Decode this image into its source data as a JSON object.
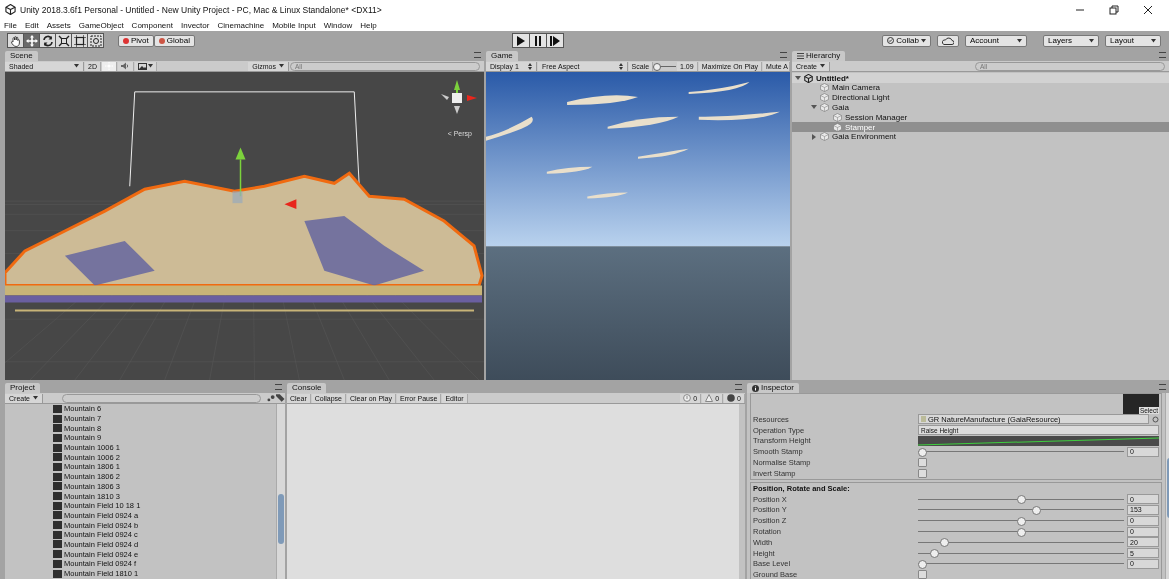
{
  "window": {
    "title": "Unity 2018.3.6f1 Personal - Untitled - New Unity Project - PC, Mac & Linux Standalone* <DX11>"
  },
  "menu": [
    "File",
    "Edit",
    "Assets",
    "GameObject",
    "Component",
    "Invector",
    "Cinemachine",
    "Mobile Input",
    "Window",
    "Help"
  ],
  "toolbar": {
    "tools": [
      {
        "kind": "hand",
        "selected": false
      },
      {
        "kind": "move",
        "selected": true
      },
      {
        "kind": "rotate",
        "selected": false
      },
      {
        "kind": "scale",
        "selected": false
      },
      {
        "kind": "rect",
        "selected": false
      },
      {
        "kind": "transform",
        "selected": false
      }
    ],
    "pivot": [
      "Pivot",
      "Global"
    ],
    "play": [
      {
        "kind": "play"
      },
      {
        "kind": "pause"
      },
      {
        "kind": "step"
      }
    ],
    "collab": "Collab",
    "account": "Account",
    "layers": "Layers",
    "layout": "Layout"
  },
  "scene": {
    "tab": "Scene",
    "shading": "Shaded",
    "mode_2d": "2D",
    "lighting": {
      "on": true
    },
    "audio": {
      "on": false
    },
    "gizmos": "Gizmos",
    "search": {
      "placeholder": "All"
    },
    "projection": "< Persp"
  },
  "game": {
    "tab": "Game",
    "display": "Display 1",
    "aspect": "Free Aspect",
    "scale_label": "Scale",
    "scale_slider": {
      "level": 0.1
    },
    "scale_value": "1.09",
    "maximize": "Maximize On Play",
    "mute": "Mute A"
  },
  "hierarchy": {
    "tab": "Hierarchy",
    "create": "Create",
    "search": {
      "placeholder": "All"
    },
    "scene": "Untitled*",
    "items": [
      {
        "label": "Main Camera",
        "selected": false
      },
      {
        "label": "Directional Light",
        "selected": false
      },
      {
        "label": "Gaia",
        "selected": false,
        "expanded": true,
        "children": [
          {
            "label": "Session Manager",
            "selected": false
          },
          {
            "label": "Stamper",
            "selected": true
          }
        ]
      },
      {
        "label": "Gaia Environment",
        "selected": false,
        "expanded": false
      }
    ]
  },
  "project": {
    "tab": "Project",
    "create": "Create",
    "items": [
      "Mountain 6",
      "Mountain 7",
      "Mountain 8",
      "Mountain 9",
      "Mountain 1006 1",
      "Mountain 1006 2",
      "Mountain 1806 1",
      "Mountain 1806 2",
      "Mountain 1806 3",
      "Mountain 1810 3",
      "Mountain Field 10 18 1",
      "Mountain Field 0924 a",
      "Mountain Field 0924 b",
      "Mountain Field 0924 c",
      "Mountain Field 0924 d",
      "Mountain Field 0924 e",
      "Mountain Field 0924 f",
      "Mountain Field 1810 1"
    ]
  },
  "console": {
    "tab": "Console",
    "buttons": [
      "Clear",
      "Collapse",
      "Clear on Play",
      "Error Pause",
      "Editor"
    ],
    "counts": [
      {
        "kind": "info",
        "value": "0"
      },
      {
        "kind": "warning",
        "value": "0"
      },
      {
        "kind": "error",
        "value": "0"
      }
    ]
  },
  "inspector": {
    "tab": "Inspector",
    "select": "Select",
    "rows": [
      {
        "kind": "object",
        "label": "Resources",
        "value": "GR NatureManufacture (GaiaResource)"
      },
      {
        "kind": "dropdown",
        "label": "Operation Type",
        "value": "Raise Height"
      },
      {
        "kind": "curve",
        "label": "Transform Height"
      },
      {
        "kind": "slider",
        "label": "Smooth Stamp",
        "level": 0,
        "value": "0"
      },
      {
        "kind": "checkbox",
        "label": "Normalise Stamp",
        "checked": false
      },
      {
        "kind": "checkbox",
        "label": "Invert Stamp",
        "checked": false
      }
    ],
    "section": "Position, Rotate and Scale:",
    "section_rows": [
      {
        "kind": "slider",
        "label": "Position X",
        "level": 0.5,
        "value": "0"
      },
      {
        "kind": "slider",
        "label": "Position Y",
        "level": 0.575,
        "value": "153"
      },
      {
        "kind": "slider",
        "label": "Position Z",
        "level": 0.5,
        "value": "0"
      },
      {
        "kind": "slider",
        "label": "Rotation",
        "level": 0.5,
        "value": "0"
      },
      {
        "kind": "slider",
        "label": "Width",
        "level": 0.11,
        "value": "20"
      },
      {
        "kind": "slider",
        "label": "Height",
        "level": 0.06,
        "value": "5"
      },
      {
        "kind": "slider",
        "label": "Base Level",
        "level": 0,
        "value": "0"
      },
      {
        "kind": "checkbox",
        "label": "Ground Base",
        "checked": false
      }
    ]
  }
}
